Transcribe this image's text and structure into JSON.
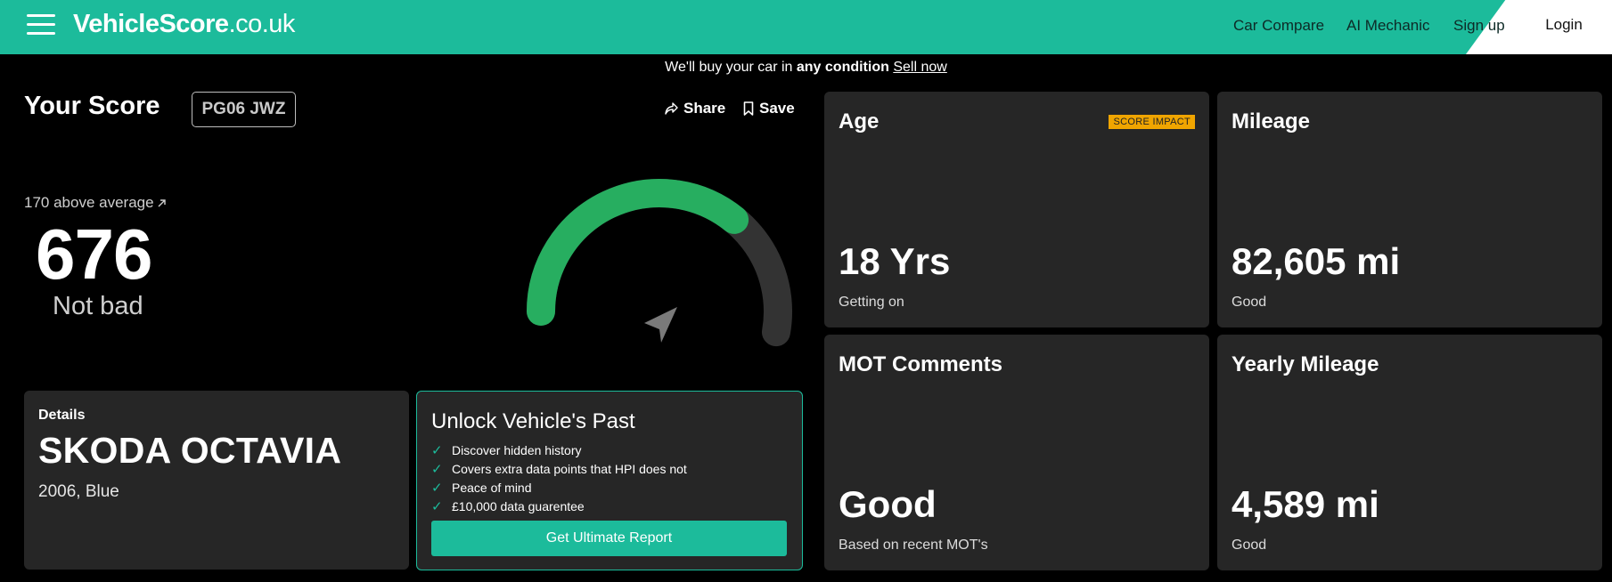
{
  "header": {
    "logo_bold": "VehicleScore",
    "logo_tld": ".co.uk",
    "nav": [
      "Car Compare",
      "AI Mechanic",
      "Sign up"
    ],
    "login": "Login",
    "brand_color": "#1cbb9b"
  },
  "promo": {
    "text_before": "We'll buy your car in ",
    "emphasis": "any condition",
    "link": "Sell now"
  },
  "score": {
    "title": "Your Score",
    "plate": "PG06 JWZ",
    "share": "Share",
    "save": "Save",
    "comparison": "170 above average",
    "value": "676",
    "verdict": "Not bad",
    "gauge_fill_fraction": 0.68,
    "gauge_color": "#27ae60"
  },
  "details": {
    "label": "Details",
    "model": "SKODA OCTAVIA",
    "sub": "2006, Blue"
  },
  "unlock": {
    "title": "Unlock Vehicle's Past",
    "items": [
      "Discover hidden history",
      "Covers extra data points that HPI does not",
      "Peace of mind",
      "£10,000 data guarentee"
    ],
    "button": "Get Ultimate Report"
  },
  "stats": {
    "age": {
      "title": "Age",
      "badge": "SCORE IMPACT",
      "value": "18 Yrs",
      "sub": "Getting on"
    },
    "mileage": {
      "title": "Mileage",
      "value": "82,605 mi",
      "sub": "Good"
    },
    "mot": {
      "title": "MOT Comments",
      "value": "Good",
      "sub": "Based on recent MOT's"
    },
    "yearly": {
      "title": "Yearly Mileage",
      "value": "4,589 mi",
      "sub": "Good"
    }
  }
}
